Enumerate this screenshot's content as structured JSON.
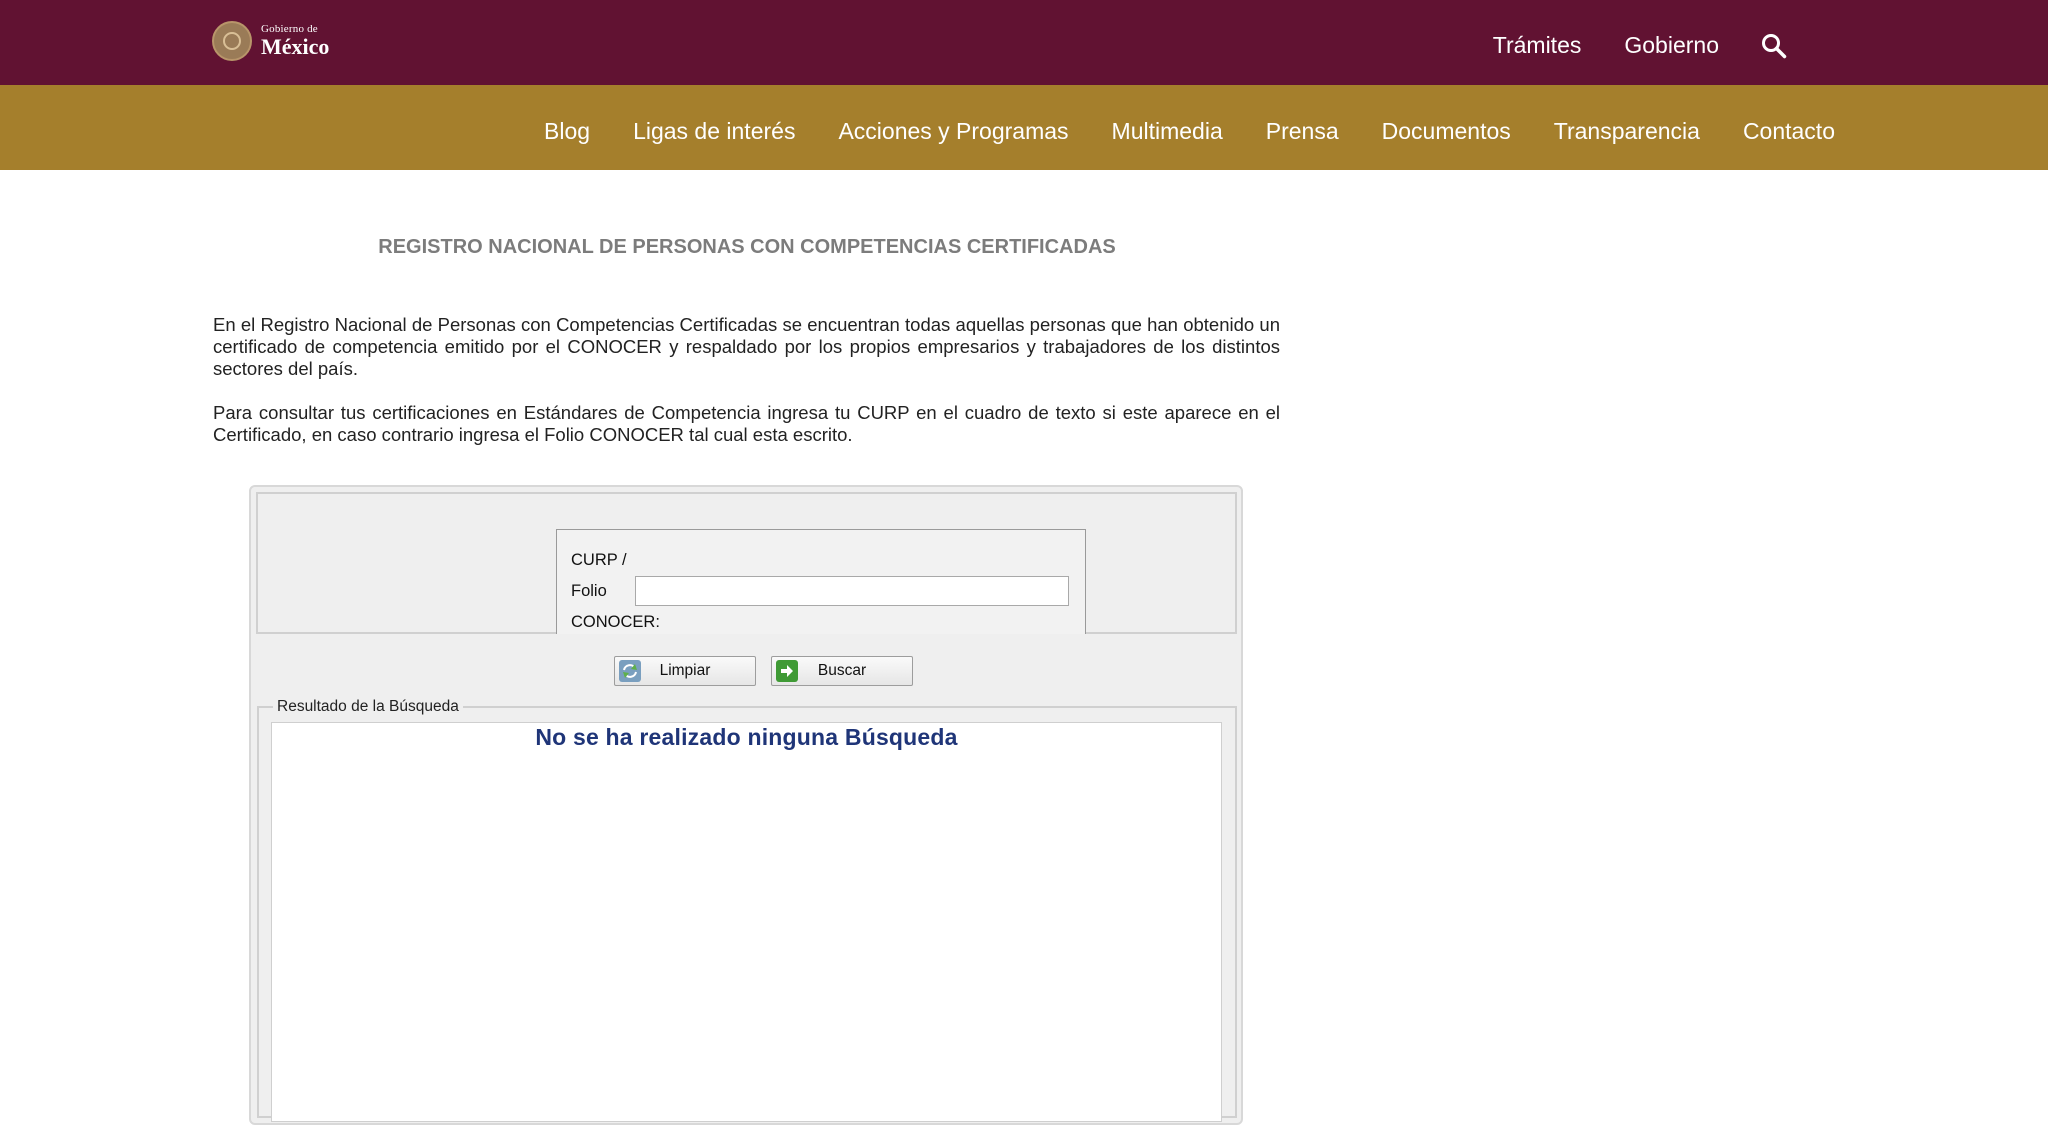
{
  "header": {
    "logo_small": "Gobierno de",
    "logo_big": "México",
    "links": [
      "Trámites",
      "Gobierno"
    ]
  },
  "nav": {
    "items": [
      "Blog",
      "Ligas de interés",
      "Acciones y Programas",
      "Multimedia",
      "Prensa",
      "Documentos",
      "Transparencia",
      "Contacto"
    ]
  },
  "main": {
    "title": "REGISTRO NACIONAL DE PERSONAS CON COMPETENCIAS CERTIFICADAS",
    "paragraph1": "En el Registro Nacional de Personas con Competencias Certificadas se encuentran todas aquellas personas que han obtenido un certificado de competencia emitido por el CONOCER y respaldado por los propios empresarios y trabajadores de los distintos sectores del país.",
    "paragraph2": "Para consultar tus certificaciones en Estándares de Competencia ingresa tu CURP en el cuadro de texto si este aparece en el Certificado, en caso contrario ingresa el Folio CONOCER tal cual esta escrito."
  },
  "form": {
    "label_line1": "CURP /",
    "label_line2": "Folio",
    "label_line3": "CONOCER:",
    "input_value": "",
    "clear_label": "Limpiar",
    "search_label": "Buscar"
  },
  "results": {
    "legend": "Resultado de la Búsqueda",
    "message": "No se ha realizado ninguna Búsqueda"
  },
  "colors": {
    "topbar": "#611232",
    "subnav": "#a57f2c",
    "message": "#1f3578"
  }
}
